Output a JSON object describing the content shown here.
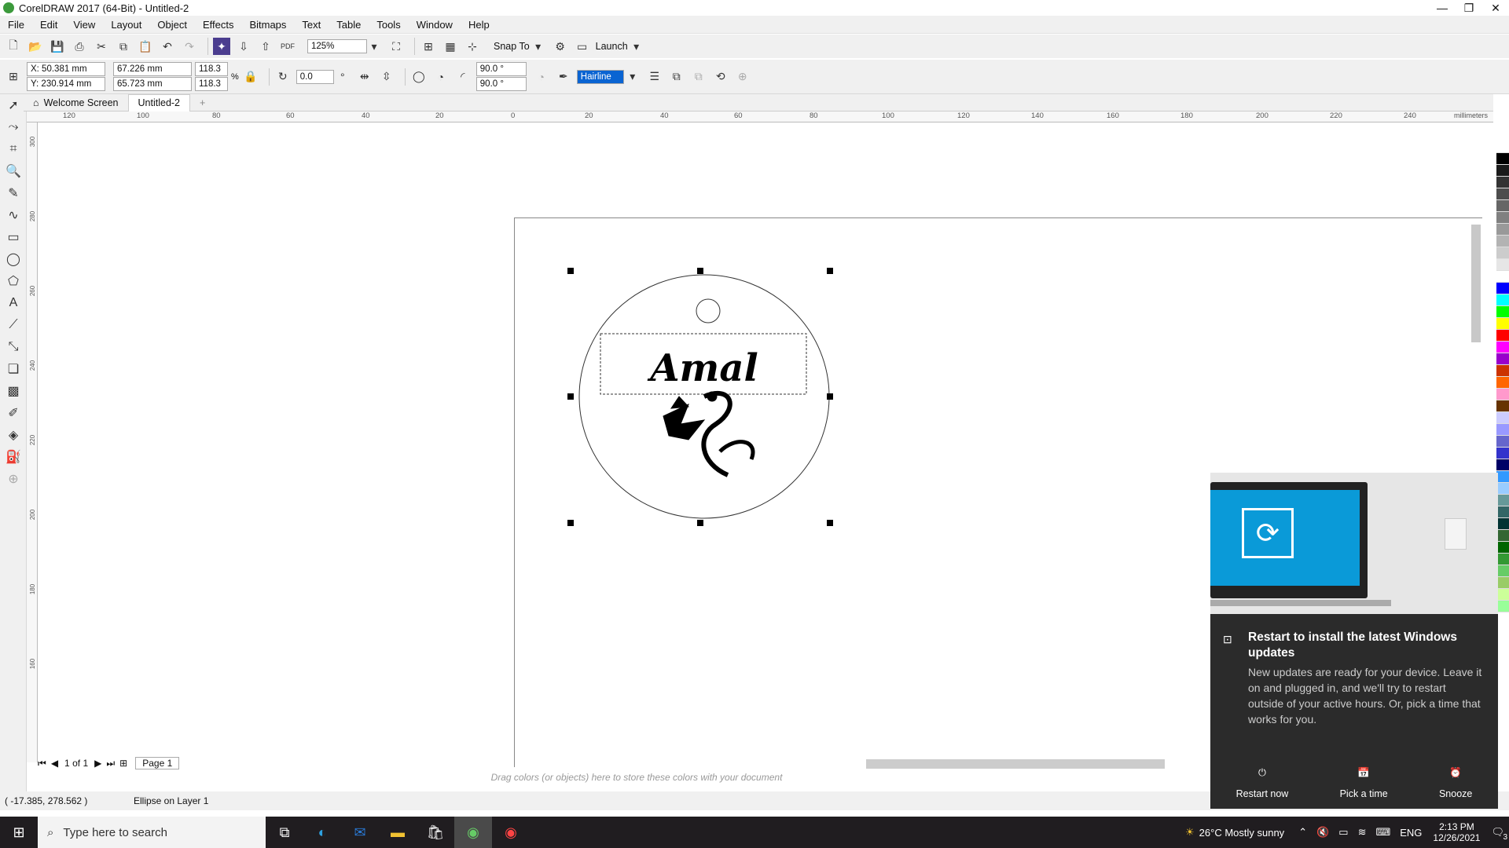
{
  "window": {
    "title": "CorelDRAW 2017 (64-Bit) - Untitled-2"
  },
  "menu": [
    "File",
    "Edit",
    "View",
    "Layout",
    "Object",
    "Effects",
    "Bitmaps",
    "Text",
    "Table",
    "Tools",
    "Window",
    "Help"
  ],
  "toolbar1": {
    "zoom": "125%",
    "snap": "Snap To",
    "launch": "Launch",
    "pdf": "PDF"
  },
  "props": {
    "x": "X: 50.381 mm",
    "y": "Y: 230.914 mm",
    "w": "67.226 mm",
    "h": "65.723 mm",
    "sx": "118.3",
    "sy": "118.3",
    "pct": "%",
    "rot": "0.0",
    "a1": "90.0 °",
    "a2": "90.0 °",
    "outline": "Hairline"
  },
  "tabs": [
    "Welcome Screen",
    "Untitled-2"
  ],
  "ruler": {
    "h": [
      "120",
      "100",
      "80",
      "60",
      "40",
      "20",
      "0",
      "20",
      "40",
      "60",
      "80",
      "100",
      "120",
      "140",
      "160",
      "180",
      "200",
      "220",
      "240"
    ],
    "unit": "millimeters",
    "v": [
      "300",
      "280",
      "260",
      "240",
      "220",
      "200",
      "180",
      "160"
    ]
  },
  "canvas": {
    "text": "Amal"
  },
  "pagenav": {
    "current": "1",
    "of": "of",
    "total": "1",
    "page": "Page 1"
  },
  "colorhint": "Drag colors (or objects) here to store these colors with your document",
  "status": {
    "coords": "( -17.385, 278.562 )",
    "info": "Ellipse on Layer 1"
  },
  "toast": {
    "title": "Restart to install the latest Windows updates",
    "body": "New updates are ready for your device. Leave it on and plugged in, and we'll try to restart outside of your active hours. Or, pick a time that works for you.",
    "restart": "Restart now",
    "pick": "Pick a time",
    "snooze": "Snooze"
  },
  "taskbar": {
    "search": "Type here to search",
    "weather": "26°C  Mostly sunny",
    "lang": "ENG",
    "time": "2:13 PM",
    "date": "12/26/2021",
    "notif": "3"
  },
  "palette": [
    "#ffffff",
    "#000000",
    "#1a1a1a",
    "#333333",
    "#4d4d4d",
    "#666666",
    "#808080",
    "#999999",
    "#b3b3b3",
    "#cccccc",
    "#e6e6e6",
    "#ffffff",
    "#0000ff",
    "#00ffff",
    "#00ff00",
    "#ffff00",
    "#ff0000",
    "#ff00ff",
    "#9900cc",
    "#cc3300",
    "#ff6600",
    "#ff99cc",
    "#663300",
    "#ccccff",
    "#9999ff",
    "#6666cc",
    "#3333cc",
    "#000066",
    "#3399ff",
    "#99ccff",
    "#669999",
    "#336666",
    "#003333",
    "#336633",
    "#006600",
    "#339933",
    "#66cc66",
    "#99cc66",
    "#ccff99",
    "#99ff99"
  ]
}
